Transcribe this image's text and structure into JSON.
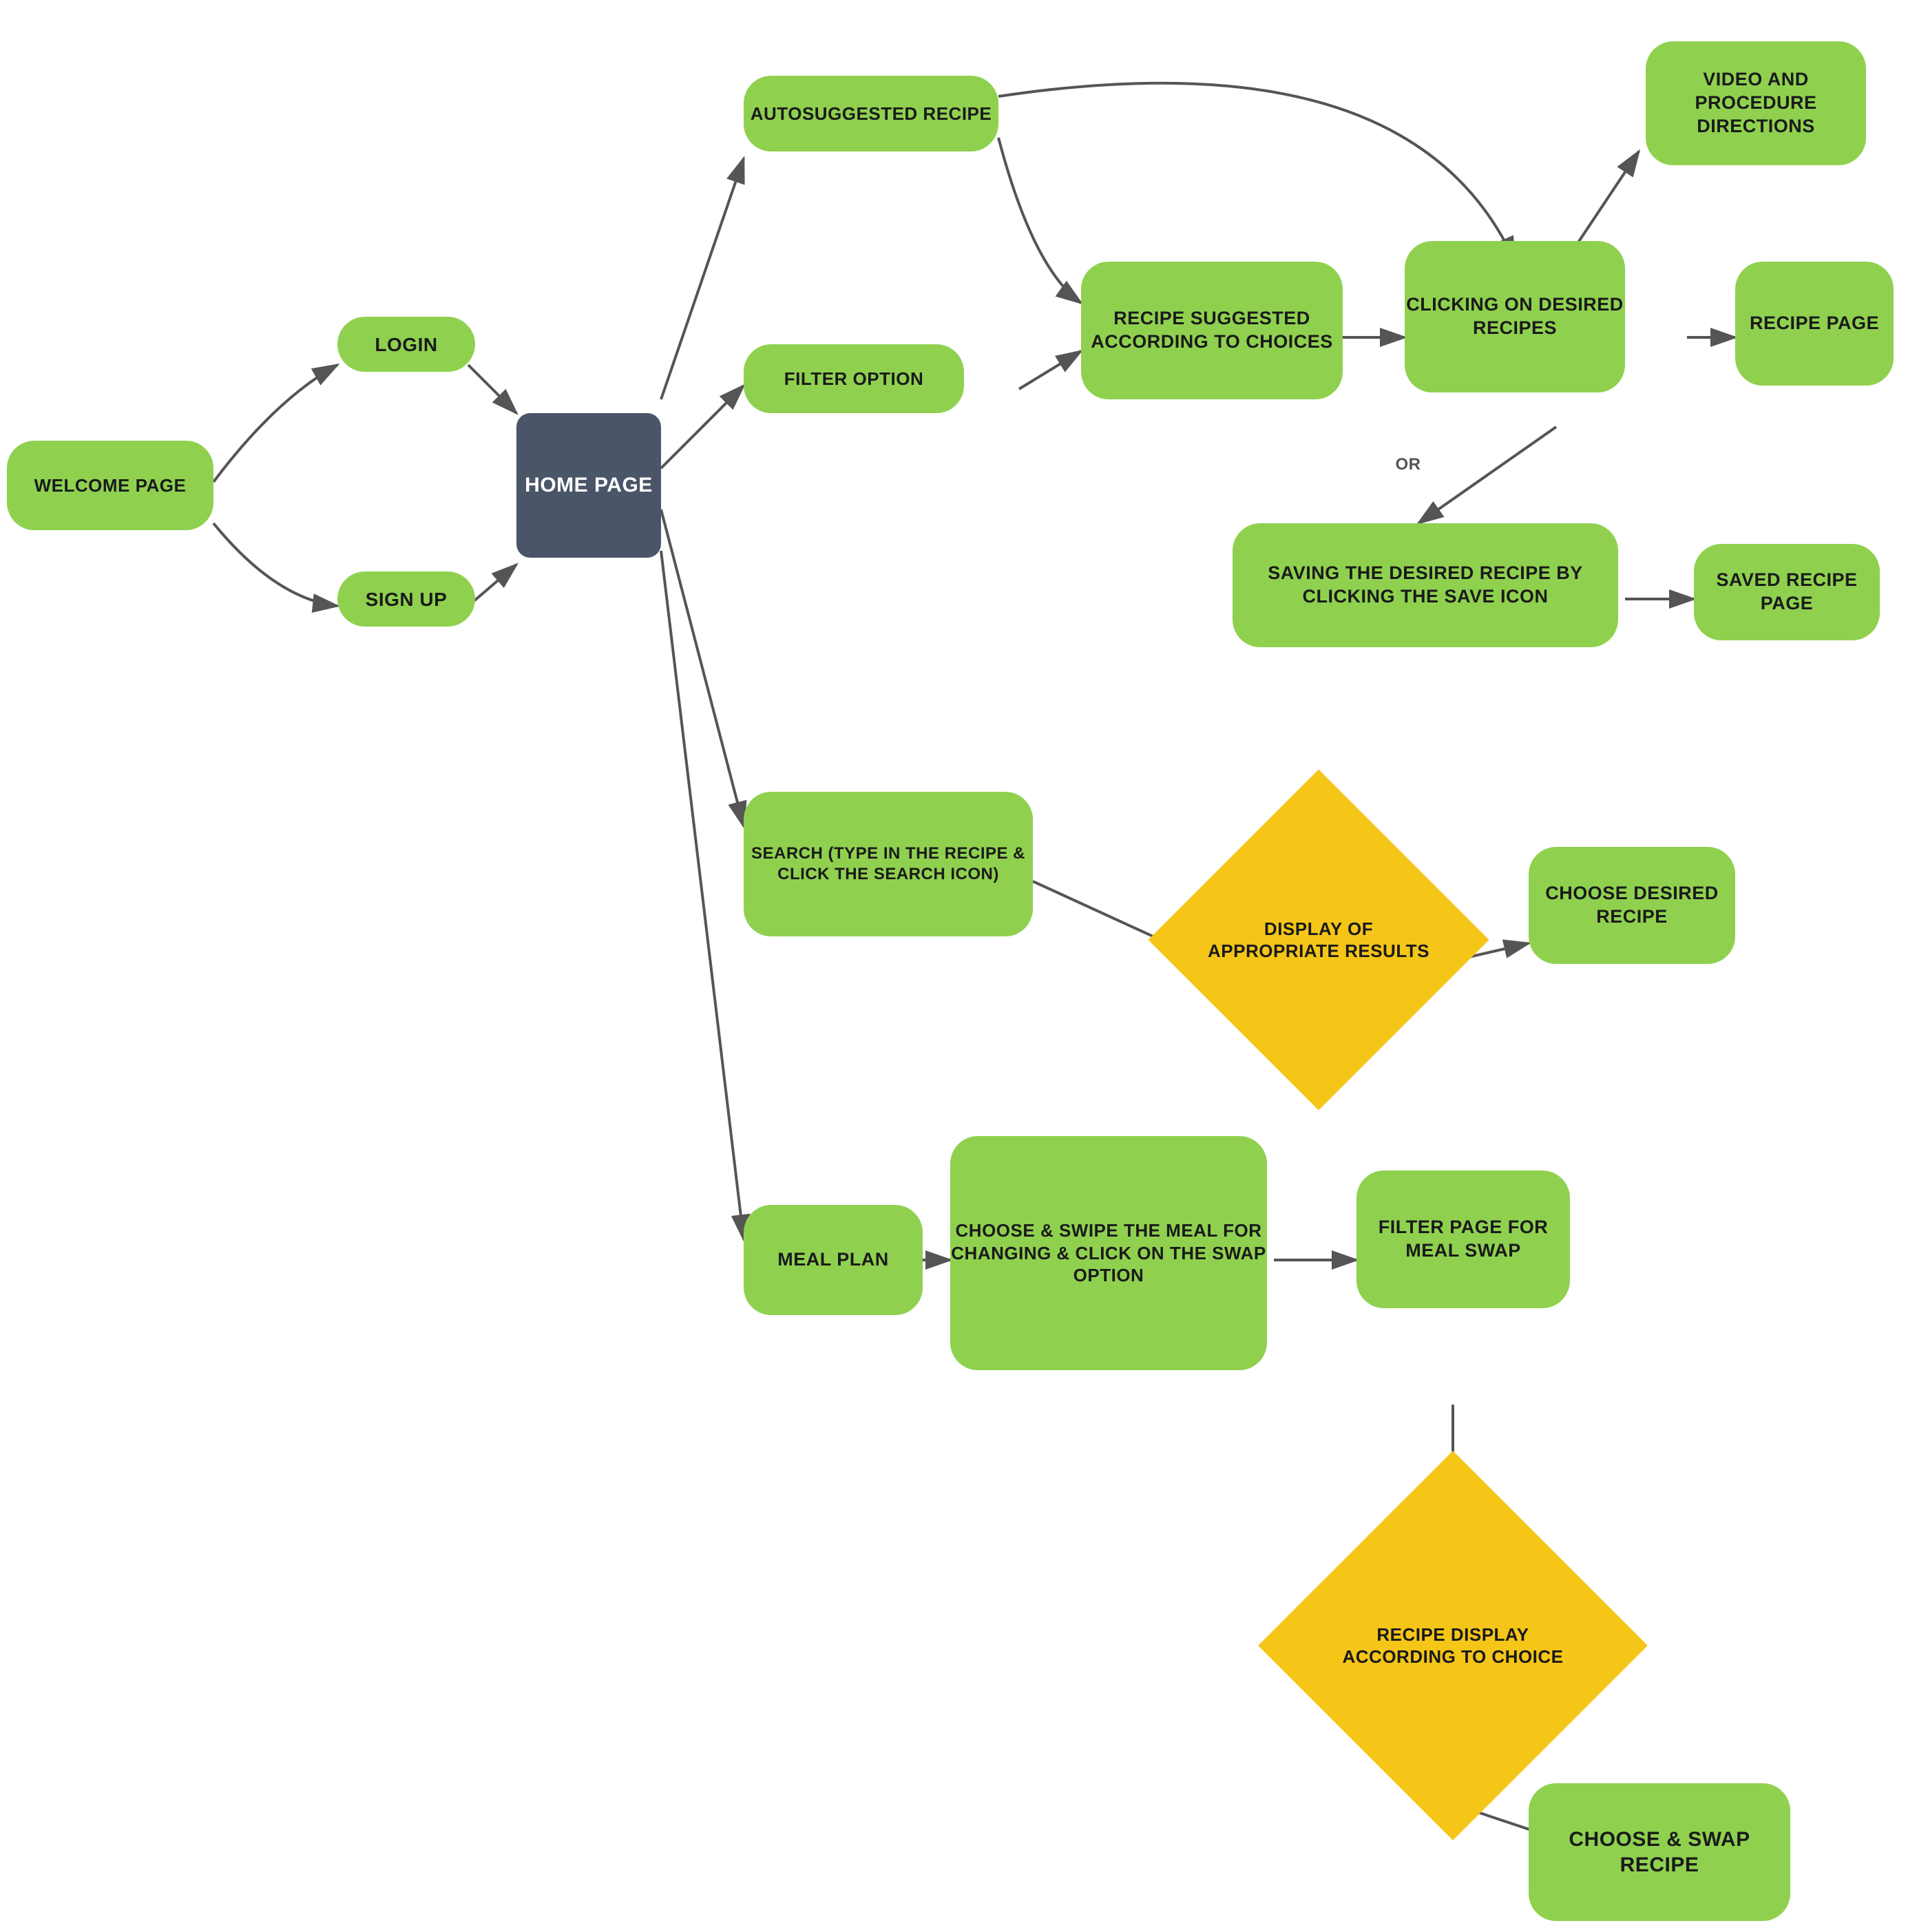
{
  "nodes": {
    "welcome_page": {
      "label": "WELCOME PAGE"
    },
    "login": {
      "label": "LOGIN"
    },
    "signup": {
      "label": "SIGN UP"
    },
    "home_page": {
      "label": "HOME\nPAGE"
    },
    "autosuggested": {
      "label": "AUTOSUGGESTED\nRECIPE"
    },
    "filter_option": {
      "label": "FILTER OPTION"
    },
    "recipe_suggested": {
      "label": "RECIPE SUGGESTED\nACCORDING TO\nCHOICES"
    },
    "clicking_desired": {
      "label": "CLICKING ON\nDESIRED\nRECIPES"
    },
    "video_procedure": {
      "label": "VIDEO AND\nPROCEDURE\nDIRECTIONS"
    },
    "recipe_page": {
      "label": "RECIPE\nPAGE"
    },
    "saving_recipe": {
      "label": "SAVING THE DESIRED RECIPE\nBY CLICKING THE SAVE ICON"
    },
    "saved_recipe_page": {
      "label": "SAVED\nRECIPE PAGE"
    },
    "search": {
      "label": "SEARCH\n(TYPE IN THE RECIPE & CLICK\nTHE SEARCH ICON)"
    },
    "display_results": {
      "label": "DISPLAY OF\nAPPROPRIATE\nRESULTS"
    },
    "choose_desired": {
      "label": "CHOOSE\nDESIRED RECIPE"
    },
    "meal_plan": {
      "label": "MEAL\nPLAN"
    },
    "choose_swipe": {
      "label": "CHOOSE & SWIPE THE\nMEAL FOR CHANGING &\nCLICK ON THE SWAP\nOPTION"
    },
    "filter_meal_swap": {
      "label": "FILTER PAGE\nFOR MEAL\nSWAP"
    },
    "recipe_display": {
      "label": "RECIPE\nDISPLAY\nACCORDING\nTO CHOICE"
    },
    "choose_swap": {
      "label": "CHOOSE &\nSWAP RECIPE"
    },
    "or_label": {
      "label": "OR"
    }
  }
}
